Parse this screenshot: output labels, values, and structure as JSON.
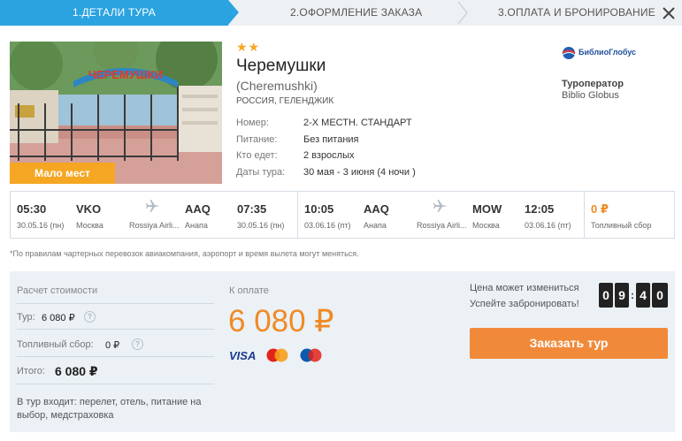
{
  "steps": [
    {
      "label": "1.ДЕТАЛИ ТУРА",
      "active": true
    },
    {
      "label": "2.ОФОРМЛЕНИЕ ЗАКАЗА",
      "active": false
    },
    {
      "label": "3.ОПЛАТА И БРОНИРОВАНИЕ",
      "active": false
    }
  ],
  "hotel": {
    "stars": "★★",
    "name": "Черемушки",
    "latin_name": "(Cheremushki)",
    "location": "РОССИЯ, ГЕЛЕНДЖИК",
    "photo_sign": "ЧЕРЕМУШКИ",
    "badge": "Мало мест",
    "details": [
      {
        "label": "Номер:",
        "value": "2-Х МЕСТН. СТАНДАРТ"
      },
      {
        "label": "Питание:",
        "value": "Без питания"
      },
      {
        "label": "Кто едет:",
        "value": "2 взрослых"
      },
      {
        "label": "Даты тура:",
        "value": "30 мая - 3 июня (4 ночи )"
      }
    ]
  },
  "operator": {
    "logo_text": "БиблиоГлобус",
    "title": "Туроператор",
    "name": "Biblio Globus"
  },
  "flights": {
    "outbound": {
      "dep_time": "05:30",
      "dep_code": "VKO",
      "dep_date": "30.05.16 (пн)",
      "dep_city": "Москва",
      "airline": "Rossiya Airli...",
      "arr_code": "AAQ",
      "arr_city": "Анапа",
      "arr_time": "07:35",
      "arr_date": "30.05.16 (пн)"
    },
    "inbound": {
      "dep_time": "10:05",
      "dep_code": "AAQ",
      "dep_date": "03.06.16 (пт)",
      "dep_city": "Анапа",
      "airline": "Rossiya Airli...",
      "arr_code": "MOW",
      "arr_city": "Москва",
      "arr_time": "12:05",
      "arr_date": "03.06.16 (пт)"
    },
    "fee": {
      "value": "0 ₽",
      "label": "Топливный сбор"
    }
  },
  "note": "*По правилам чартерных перевозок авиакомпания, аэропорт и время вылета могут меняться.",
  "calculation": {
    "title": "Расчет стоимости",
    "tour_label": "Тур:",
    "tour_value": "6 080 ₽",
    "fuel_label": "Топливный сбор:",
    "fuel_value": "0 ₽",
    "total_label": "Итого:",
    "total_value": "6 080 ₽",
    "includes": "В тур входит: перелет, отель, питание на выбор, медстраховка",
    "help_glyph": "?"
  },
  "payment": {
    "title": "К оплате",
    "amount": "6 080 ₽",
    "cards": [
      "VISA",
      "MasterCard",
      "Maestro"
    ]
  },
  "booking": {
    "line1": "Цена может измениться",
    "line2": "Успейте забронировать!",
    "timer_digits": [
      "0",
      "9",
      "4",
      "0"
    ],
    "button": "Заказать тур"
  },
  "colors": {
    "accent_blue": "#2aa3e0",
    "orange": "#f08a24",
    "badge_orange": "#f5a623",
    "panel_bg": "#ebf1f5"
  }
}
